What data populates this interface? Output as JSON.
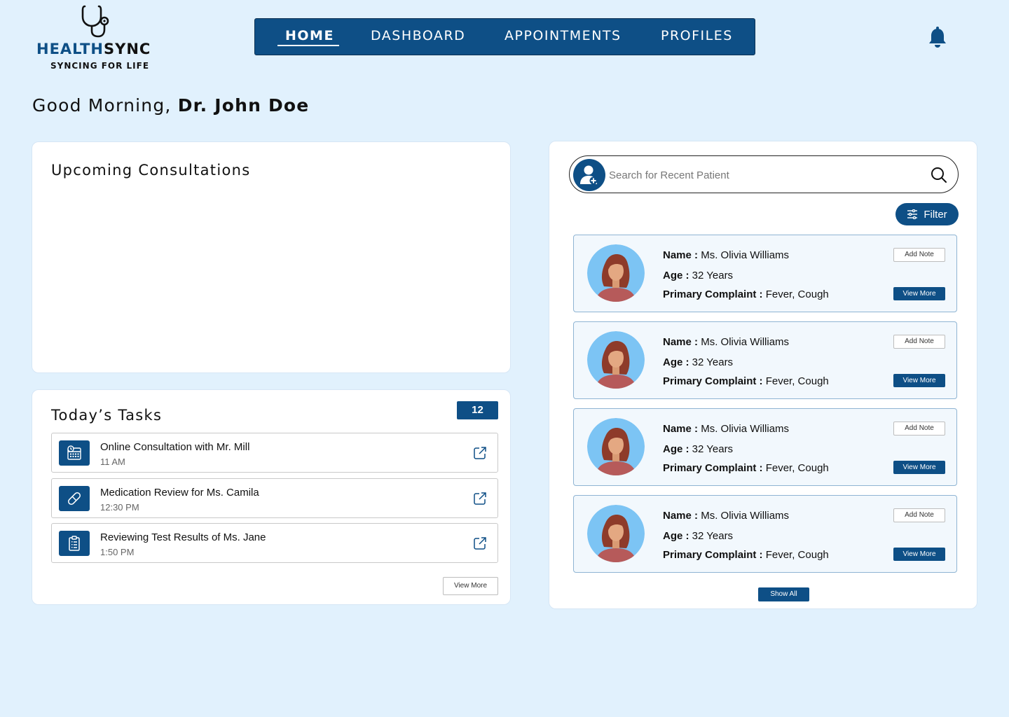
{
  "brand": {
    "name_part1": "HEALTH",
    "name_part2": "SYNC",
    "tagline": "SYNCING FOR LIFE"
  },
  "nav": {
    "tabs": [
      {
        "label": "HOME",
        "active": true
      },
      {
        "label": "DASHBOARD",
        "active": false
      },
      {
        "label": "APPOINTMENTS",
        "active": false
      },
      {
        "label": "PROFILES",
        "active": false
      }
    ]
  },
  "greeting": {
    "prefix": "Good Morning, ",
    "name": "Dr. John Doe"
  },
  "consultations": {
    "title": "Upcoming Consultations"
  },
  "tasks": {
    "title": "Today’s Tasks",
    "count": "12",
    "items": [
      {
        "name": "Online Consultation with Mr. Mill",
        "time": "11 AM",
        "icon": "calendar-clock-icon"
      },
      {
        "name": "Medication Review for Ms. Camila",
        "time": "12:30 PM",
        "icon": "pill-icon"
      },
      {
        "name": "Reviewing Test Results of Ms. Jane",
        "time": "1:50 PM",
        "icon": "clipboard-icon"
      }
    ],
    "view_more_label": "View More"
  },
  "patients": {
    "search_placeholder": "Search for Recent Patient",
    "filter_label": "Filter",
    "labels": {
      "name": "Name :",
      "age": "Age :",
      "complaint": "Primary Complaint :"
    },
    "add_note_label": "Add Note",
    "view_more_label": "View More",
    "show_all_label": "Show All",
    "items": [
      {
        "name": "Ms. Olivia Williams",
        "age": "32 Years",
        "complaint": "Fever, Cough"
      },
      {
        "name": "Ms. Olivia Williams",
        "age": "32 Years",
        "complaint": "Fever, Cough"
      },
      {
        "name": "Ms. Olivia Williams",
        "age": "32 Years",
        "complaint": "Fever, Cough"
      },
      {
        "name": "Ms. Olivia Williams",
        "age": "32 Years",
        "complaint": "Fever, Cough"
      }
    ]
  },
  "colors": {
    "primary": "#0e4f86",
    "background": "#e1f1fd",
    "card": "#ffffff",
    "patient_card": "#f2f8fd",
    "avatar_bg": "#7cc4f4"
  }
}
